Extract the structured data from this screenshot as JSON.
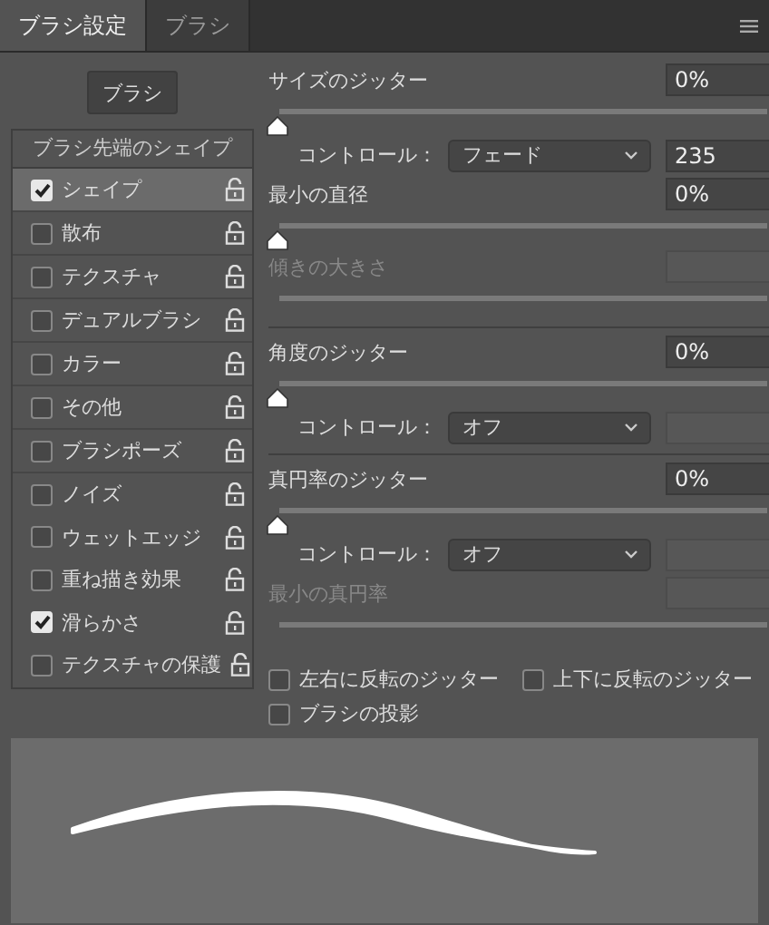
{
  "tabs": [
    {
      "label": "ブラシ設定",
      "selected": true
    },
    {
      "label": "ブラシ",
      "selected": false
    }
  ],
  "brushes_button": "ブラシ",
  "sidebar": {
    "header": "ブラシ先端のシェイプ",
    "groups": [
      [
        {
          "label": "シェイプ",
          "checked": true,
          "selected": true
        },
        {
          "label": "散布",
          "checked": false,
          "selected": false
        },
        {
          "label": "テクスチャ",
          "checked": false,
          "selected": false
        },
        {
          "label": "デュアルブラシ",
          "checked": false,
          "selected": false
        },
        {
          "label": "カラー",
          "checked": false,
          "selected": false
        },
        {
          "label": "その他",
          "checked": false,
          "selected": false
        },
        {
          "label": "ブラシポーズ",
          "checked": false,
          "selected": false
        }
      ],
      [
        {
          "label": "ノイズ",
          "checked": false,
          "selected": false
        },
        {
          "label": "ウェットエッジ",
          "checked": false,
          "selected": false
        },
        {
          "label": "重ね描き効果",
          "checked": false,
          "selected": false
        },
        {
          "label": "滑らかさ",
          "checked": true,
          "selected": false
        },
        {
          "label": "テクスチャの保護",
          "checked": false,
          "selected": false
        }
      ]
    ]
  },
  "sections": [
    [
      {
        "kind": "slider",
        "label": "サイズのジッター",
        "value": "0%",
        "level": 0,
        "disabled": false
      },
      {
        "kind": "control",
        "label": "コントロール：",
        "dropdown": "フェード",
        "value": "235",
        "disabled": false
      },
      {
        "kind": "slider",
        "label": "最小の直径",
        "value": "0%",
        "level": 0,
        "disabled": false
      },
      {
        "kind": "slider",
        "label": "傾きの大きさ",
        "disabled": true
      }
    ],
    [
      {
        "kind": "slider",
        "label": "角度のジッター",
        "value": "0%",
        "level": 0,
        "disabled": false
      },
      {
        "kind": "control",
        "label": "コントロール：",
        "dropdown": "オフ",
        "disabled": false
      }
    ],
    [
      {
        "kind": "slider",
        "label": "真円率のジッター",
        "value": "0%",
        "level": 0,
        "disabled": false
      },
      {
        "kind": "control",
        "label": "コントロール：",
        "dropdown": "オフ",
        "disabled": false
      },
      {
        "kind": "slider",
        "label": "最小の真円率",
        "disabled": true
      }
    ]
  ],
  "options": [
    {
      "label": "左右に反転のジッター",
      "checked": false
    },
    {
      "label": "上下に反転のジッター",
      "checked": false
    },
    {
      "label": "ブラシの投影",
      "checked": false
    }
  ]
}
